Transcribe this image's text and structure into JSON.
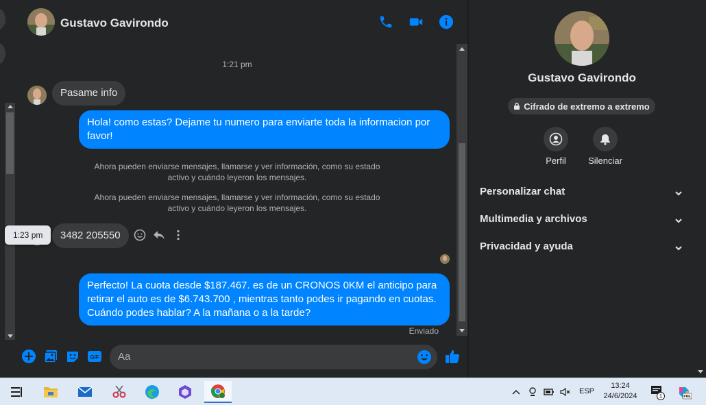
{
  "chat": {
    "contact_name": "Gustavo Gavirondo",
    "timestamp_1": "1:21 pm",
    "msg_in_1": "Pasame info",
    "msg_out_1_line1": "Hola! como estas? Dejame tu numero para enviarte toda la informacion por",
    "msg_out_1_line2": "favor!",
    "sys_1_line1": "Ahora pueden enviarse mensajes, llamarse y ver información, como su estado",
    "sys_1_line2": "activo y cuándo leyeron los mensajes.",
    "sys_2_line1": "Ahora pueden enviarse mensajes, llamarse y ver información, como su estado",
    "sys_2_line2": "activo y cuándo leyeron los mensajes.",
    "tooltip_time": "1:23 pm",
    "msg_in_2": "3482 205550",
    "msg_out_2_line1": "Perfecto! La cuota desde $187.467. es de un CRONOS 0KM el anticipo para",
    "msg_out_2_line2": "retirar el auto es de $6.743.700 , mientras tanto podes ir pagando en cuotas.",
    "msg_out_2_line3": "Cuándo podes hablar? A la mañana o a la tarde?",
    "sent_status": "Enviado",
    "composer_placeholder": "Aa",
    "gif_label": "GIF"
  },
  "info_panel": {
    "name": "Gustavo Gavirondo",
    "e2e_label": "Cifrado de extremo a extremo",
    "profile_label": "Perfil",
    "mute_label": "Silenciar",
    "sections": [
      "Personalizar chat",
      "Multimedia y archivos",
      "Privacidad y ayuda"
    ]
  },
  "taskbar": {
    "language": "ESP",
    "time": "13:24",
    "date": "24/6/2024",
    "notification_count": "1",
    "copilot_badge": "PRE"
  },
  "colors": {
    "accent": "#0084ff",
    "background": "#242526",
    "bubble_in": "#3a3b3c",
    "taskbar": "#dfe9f5"
  },
  "icons": [
    "phone-icon",
    "video-icon",
    "info-icon",
    "emoji-icon",
    "reply-icon",
    "more-icon",
    "plus-icon",
    "image-icon",
    "sticker-icon",
    "gif-icon",
    "like-icon",
    "lock-icon",
    "profile-icon",
    "bell-icon",
    "chevron-down-icon"
  ]
}
